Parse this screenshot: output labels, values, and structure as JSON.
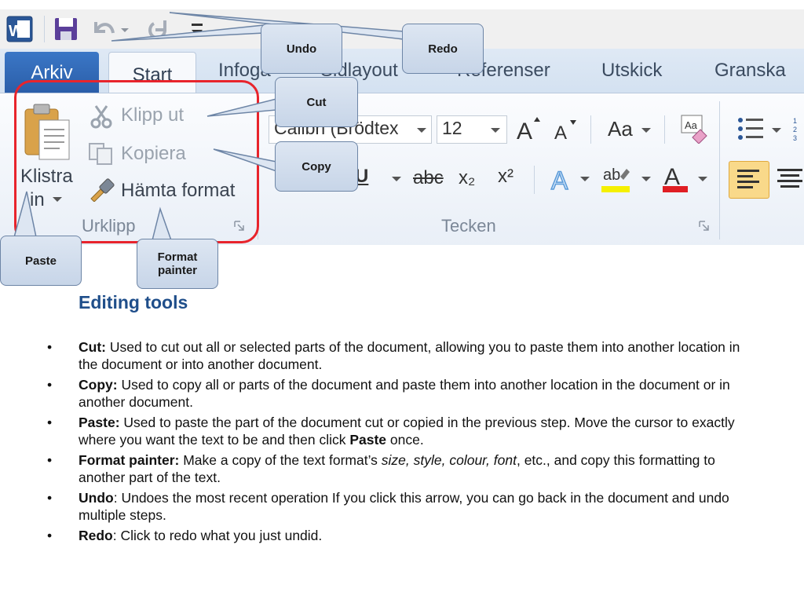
{
  "quick_access": {
    "icons": [
      "word-icon",
      "save-icon",
      "undo-icon",
      "redo-icon",
      "customize-icon"
    ]
  },
  "tabs": [
    {
      "label": "Arkiv"
    },
    {
      "label": "Start"
    },
    {
      "label": "Infoga"
    },
    {
      "label": "Sidlayout"
    },
    {
      "label": "Referenser"
    },
    {
      "label": "Utskick"
    },
    {
      "label": "Granska"
    }
  ],
  "clipboard_group": {
    "label": "Urklipp",
    "paste_label_1": "Klistra",
    "paste_label_2": "in",
    "cut_label": "Klipp ut",
    "copy_label": "Kopiera",
    "format_painter_label": "Hämta format"
  },
  "font_group": {
    "label": "Tecken",
    "font_name": "Calibri (Brödtex",
    "font_size": "12",
    "change_case_label": "Aa",
    "clear_format_label": "A",
    "underline_label": "U",
    "strike_label": "abc",
    "subscript_label": "x₂",
    "superscript_label": "x²",
    "highlight_label": "ab",
    "font_color_label": "A"
  },
  "callouts": {
    "undo": "Undo",
    "redo": "Redo",
    "cut": "Cut",
    "copy": "Copy",
    "paste": "Paste",
    "format_painter_1": "Format",
    "format_painter_2": "painter"
  },
  "heading": "Editing tools",
  "bullets": [
    {
      "term": "Cut:",
      "text": " Used to cut out all or selected parts of the document, allowing you to paste them into another location in the document or into another document."
    },
    {
      "term": "Copy:",
      "text": " Used to copy all or parts of the document and paste them into another location in the document or in another document."
    },
    {
      "term": "Paste",
      "colon": ":",
      "text": " Used to paste the part of the document cut or copied in the previous step. Move the cursor to exactly where you want the text to be and then click ",
      "bold_tail": "Paste",
      "tail": " once."
    },
    {
      "term": "Format painter:",
      "text": " Make a copy of the text format’s ",
      "italic": "size, style, colour, font",
      "tail": ", etc., and copy this formatting to another part of the text."
    },
    {
      "term": "Undo",
      "text": ": Undoes the most recent operation If you click this arrow, you can go back in the document and undo multiple steps."
    },
    {
      "term": "Redo",
      "text": ": Click to redo what you just undid."
    }
  ],
  "colors": {
    "heading": "#1f4e8a",
    "highlight_box": "#e8242c",
    "callout_fill": "#c7d5e8",
    "active_tab": "#2a5da8"
  }
}
